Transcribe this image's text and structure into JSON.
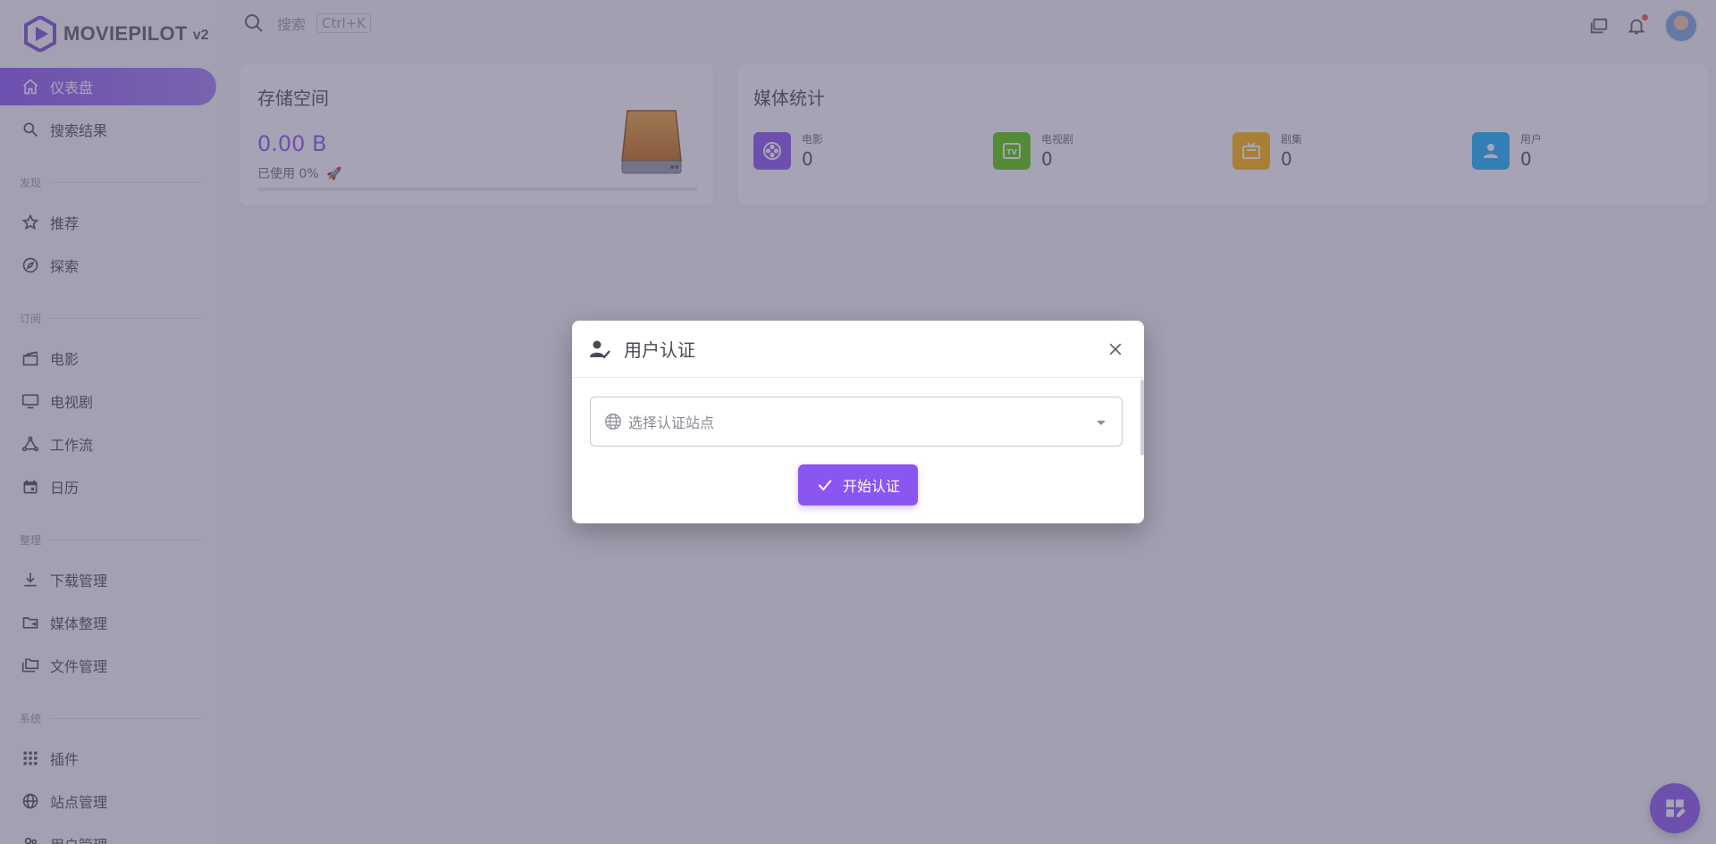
{
  "brand": {
    "name": "MOVIEPILOT",
    "version": "v2",
    "accent": "#8a55f0"
  },
  "search": {
    "placeholder": "搜索",
    "shortcut": "Ctrl+K"
  },
  "sidebar": {
    "items": [
      {
        "label": "仪表盘",
        "icon": "home-icon",
        "active": true
      },
      {
        "label": "搜索结果",
        "icon": "search-icon"
      },
      {
        "label": "推荐",
        "icon": "star-icon"
      },
      {
        "label": "探索",
        "icon": "compass-icon"
      },
      {
        "label": "电影",
        "icon": "movie-clapper-icon"
      },
      {
        "label": "电视剧",
        "icon": "monitor-icon"
      },
      {
        "label": "工作流",
        "icon": "workflow-icon"
      },
      {
        "label": "日历",
        "icon": "calendar-icon"
      },
      {
        "label": "下载管理",
        "icon": "download-icon"
      },
      {
        "label": "媒体整理",
        "icon": "folder-move-icon"
      },
      {
        "label": "文件管理",
        "icon": "folders-icon"
      },
      {
        "label": "插件",
        "icon": "grid-icon"
      },
      {
        "label": "站点管理",
        "icon": "globe-icon"
      },
      {
        "label": "用户管理",
        "icon": "users-icon"
      }
    ],
    "sections": [
      "发现",
      "订阅",
      "整理",
      "系统"
    ]
  },
  "storage": {
    "title": "存储空间",
    "value": "0.00 B",
    "used": "已使用 0%",
    "used_fraction": 0
  },
  "media_stats": {
    "title": "媒体统计",
    "items": [
      {
        "label": "电影",
        "value": "0",
        "color": "#8a55f0",
        "icon": "film-reel-icon"
      },
      {
        "label": "电视剧",
        "value": "0",
        "color": "#56ca00",
        "icon": "tv-icon"
      },
      {
        "label": "剧集",
        "value": "0",
        "color": "#ffb400",
        "icon": "television-icon"
      },
      {
        "label": "用户",
        "value": "0",
        "color": "#16b1ff",
        "icon": "user-icon"
      }
    ]
  },
  "dialog": {
    "title": "用户认证",
    "select_placeholder": "选择认证站点",
    "submit_label": "开始认证"
  }
}
